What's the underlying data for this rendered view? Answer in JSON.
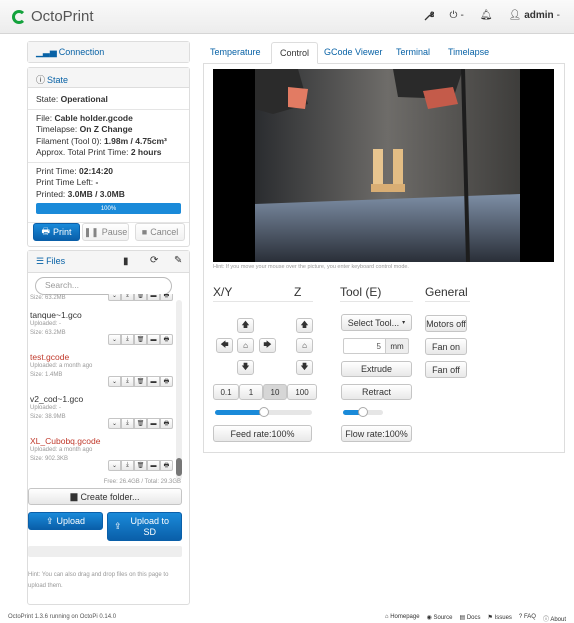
{
  "navbar": {
    "brand": "OctoPrint",
    "wrench_icon": "wrench-icon",
    "power_caret": "-",
    "bell_icon": "bell-icon",
    "user": "admin",
    "user_caret": "-"
  },
  "connection": {
    "title": "Connection"
  },
  "state": {
    "title": "State",
    "state_label": "State:",
    "state_value": "Operational",
    "file_label": "File:",
    "file_value": "Cable holder.gcode",
    "timelapse_label": "Timelapse:",
    "timelapse_value": "On Z Change",
    "filament_label": "Filament (Tool 0):",
    "filament_value": "1.98m / 4.75cm³",
    "approx_label": "Approx. Total Print Time:",
    "approx_value": "2 hours",
    "print_time_label": "Print Time:",
    "print_time_value": "02:14:20",
    "print_left_label": "Print Time Left:",
    "print_left_value": "-",
    "printed_label": "Printed:",
    "printed_value": "3.0MB / 3.0MB",
    "progress_text": "100%",
    "progress_fraction": 1.0,
    "print_button": "Print",
    "pause_button": "Pause",
    "cancel_button": "Cancel"
  },
  "files": {
    "title": "Files",
    "search_placeholder": "Search...",
    "partial_size": "Size: 63.2MB",
    "items": [
      {
        "name": "tanque~1.gco",
        "uploaded": "Uploaded: -",
        "size": "Size: 63.2MB"
      },
      {
        "name": "test.gcode",
        "uploaded": "Uploaded: a month ago",
        "size": "Size: 1.4MB"
      },
      {
        "name": "v2_cod~1.gco",
        "uploaded": "Uploaded: -",
        "size": "Size: 38.9MB"
      },
      {
        "name": "XL_Cubobq.gcode",
        "uploaded": "Uploaded: a month ago",
        "size": "Size: 902.3KB"
      }
    ],
    "free_space": "Free: 26.4GB / Total: 29.3GB",
    "create_folder": "Create folder...",
    "upload": "Upload",
    "upload_sd": "Upload to SD",
    "hint": "Hint: You can also drag and drop files on this page to upload them."
  },
  "tabs": [
    "Temperature",
    "Control",
    "GCode Viewer",
    "Terminal",
    "Timelapse"
  ],
  "control": {
    "webcam_hint": "Hint: If you move your mouse over the picture, you enter keyboard control mode.",
    "xy_title": "X/Y",
    "z_title": "Z",
    "tool_title": "Tool (E)",
    "general_title": "General",
    "step_values": [
      "0.1",
      "1",
      "10",
      "100"
    ],
    "selected_step": "10",
    "feed_rate_button": "Feed rate:100%",
    "feed_rate_fraction": 0.5,
    "select_tool": "Select Tool...",
    "extrude_amount": "5",
    "extrude_unit": "mm",
    "extrude_button": "Extrude",
    "retract_button": "Retract",
    "flow_rate_button": "Flow rate:100%",
    "flow_rate_fraction": 0.5,
    "motors_off": "Motors off",
    "fan_on": "Fan on",
    "fan_off": "Fan off"
  },
  "footer": {
    "version": "OctoPrint 1.3.6 running on OctoPi 0.14.0",
    "links": [
      "Homepage",
      "Source",
      "Docs",
      "Issues",
      "FAQ",
      "About"
    ]
  },
  "colors": {
    "accent": "#0862a6",
    "primary_button": "#1a8ad9",
    "brand_green": "#13a23c",
    "alert_red": "#c0392b"
  }
}
